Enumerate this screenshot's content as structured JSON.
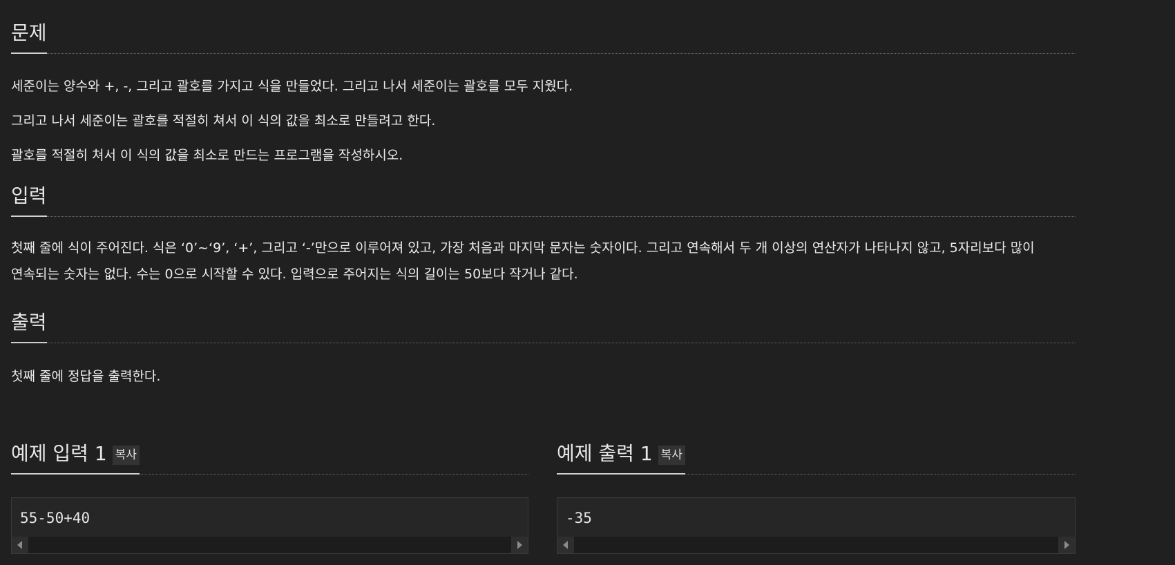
{
  "problem": {
    "heading": "문제",
    "paragraphs": [
      "세준이는 양수와 +, -, 그리고 괄호를 가지고 식을 만들었다. 그리고 나서 세준이는 괄호를 모두 지웠다.",
      "그리고 나서 세준이는 괄호를 적절히 쳐서 이 식의 값을 최소로 만들려고 한다.",
      "괄호를 적절히 쳐서 이 식의 값을 최소로 만드는 프로그램을 작성하시오."
    ]
  },
  "input": {
    "heading": "입력",
    "text": "첫째 줄에 식이 주어진다. 식은 ‘0’~‘9’, ‘+’, 그리고 ‘-’만으로 이루어져 있고, 가장 처음과 마지막 문자는 숫자이다. 그리고 연속해서 두 개 이상의 연산자가 나타나지 않고, 5자리보다 많이 연속되는 숫자는 없다. 수는 0으로 시작할 수 있다. 입력으로 주어지는 식의 길이는 50보다 작거나 같다."
  },
  "output": {
    "heading": "출력",
    "text": "첫째 줄에 정답을 출력한다."
  },
  "sample_input": {
    "heading": "예제 입력 1",
    "copy_label": "복사",
    "code": "55-50+40"
  },
  "sample_output": {
    "heading": "예제 출력 1",
    "copy_label": "복사",
    "code": "-35"
  },
  "colors": {
    "background": "#202020",
    "text": "#e6e6e6",
    "code_background": "#262626",
    "copy_button": "#333333"
  }
}
